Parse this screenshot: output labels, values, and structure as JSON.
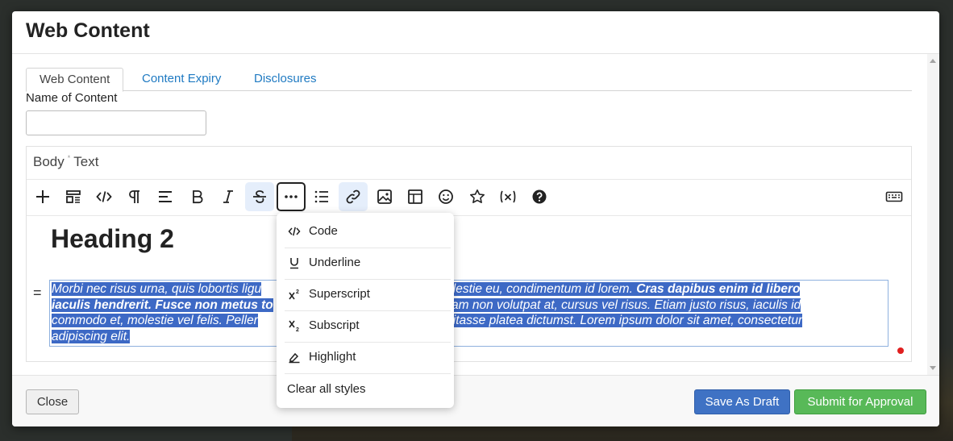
{
  "modal": {
    "title": "Web Content"
  },
  "tabs": [
    {
      "label": "Web Content",
      "active": true
    },
    {
      "label": "Content Expiry",
      "active": false
    },
    {
      "label": "Disclosures",
      "active": false
    }
  ],
  "form": {
    "name_label": "Name of Content",
    "name_value": "",
    "name_placeholder": ""
  },
  "editor": {
    "label_part1": "Body",
    "label_sep": "*",
    "label_part2": "Text",
    "toolbar_icons": [
      "plus-icon",
      "block-layout-icon",
      "source-code-icon",
      "paragraph-icon",
      "align-left-icon",
      "bold-icon",
      "italic-icon",
      "strikethrough-icon",
      "more-options-icon",
      "bullet-list-icon",
      "link-icon",
      "image-icon",
      "table-icon",
      "emoji-icon",
      "star-icon",
      "variable-icon",
      "help-icon",
      "keyboard-icon"
    ],
    "heading": "Heading 2",
    "paragraph": {
      "line1_a": "Morbi nec risus urna, quis lobortis ligu",
      "line1_b": "s molestie eu, condimentum id lorem. ",
      "line1_bold": "Cras dapibus enim id libero",
      "line2_bold": "iaculis hendrerit. Fusce non metus to",
      "line2_b": "quam non volutpat at, cursus vel risus. Etiam justo risus, iaculis id",
      "line3_a": "commodo et, molestie vel felis. Peller",
      "line3_b": "c habitasse platea dictumst. Lorem ipsum dolor sit amet, consectetur",
      "line4_a": "adipiscing elit."
    }
  },
  "dropdown": {
    "items": [
      {
        "label": "Code",
        "icon": "code-icon"
      },
      {
        "label": "Underline",
        "icon": "underline-icon"
      },
      {
        "label": "Superscript",
        "icon": "superscript-icon"
      },
      {
        "label": "Subscript",
        "icon": "subscript-icon"
      },
      {
        "label": "Highlight",
        "icon": "highlight-icon"
      },
      {
        "label": "Clear all styles",
        "icon": ""
      }
    ]
  },
  "footer": {
    "close_label": "Close",
    "draft_label": "Save As Draft",
    "submit_label": "Submit for Approval"
  },
  "colors": {
    "selection": "#3d69c5",
    "link": "#1f7ac2",
    "draft_button": "#3f72c4",
    "submit_button": "#58b958"
  }
}
